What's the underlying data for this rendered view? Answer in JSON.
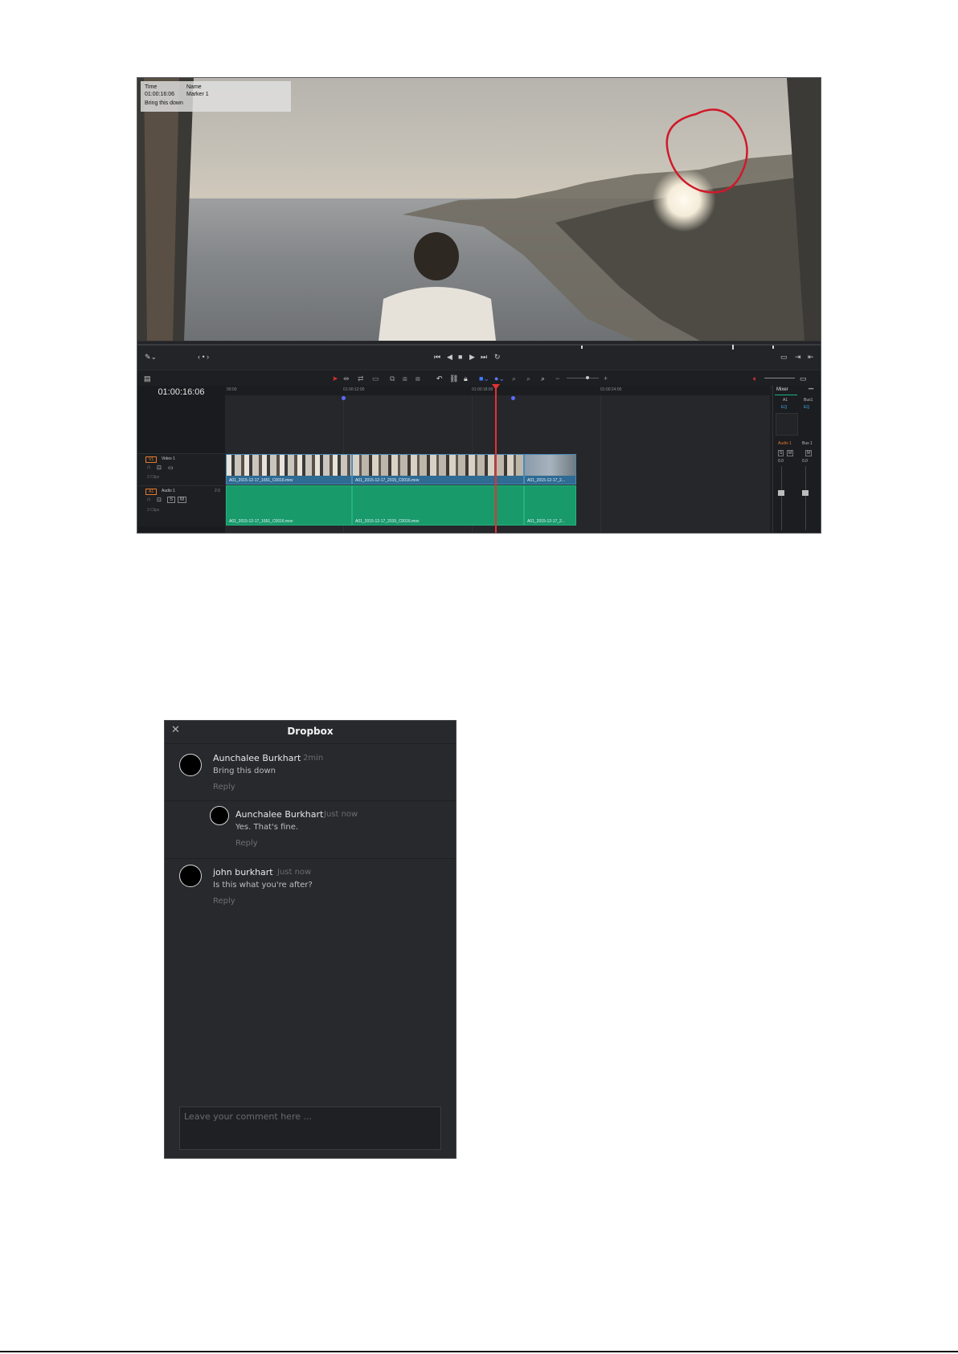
{
  "viewer": {
    "overlay": {
      "time_label": "Time",
      "time_value": "01:00:16:06",
      "name_label": "Name",
      "name_value": "Marker 1",
      "note": "Bring this down"
    },
    "annotation_color": "#d0192a"
  },
  "timeline": {
    "timecode": "01:00:16:06",
    "ruler_labels": [
      "00:00",
      "01:00:12:00",
      "01:00:18:00",
      "01:00:24:00"
    ],
    "tracks": {
      "video": {
        "id": "V1",
        "name": "Video 1",
        "clips_count": "3 Clips"
      },
      "audio": {
        "id": "A1",
        "name": "Audio 1",
        "level": "2.0",
        "clips_count": "3 Clips"
      }
    },
    "video_clips": [
      "A01_2015-12-17_1651_C0016.mov",
      "A01_2015-12-17_2015_C0016.mov",
      "A01_2015-12-17_2..."
    ],
    "audio_clips": [
      "A01_2015-12-17_1651_C0016.mov",
      "A01_2015-12-17_2015_C0016.mov",
      "A01_2015-12-17_2..."
    ]
  },
  "mixer": {
    "title": "Mixer",
    "more": "•••",
    "ch1": "A1",
    "ch2": "Bus1",
    "eq": "EQ",
    "audio1": "Audio 1",
    "bus1": "Bus 1",
    "m": "M",
    "s": "S",
    "level1": "0.0",
    "level2": "0.0"
  },
  "dropbox": {
    "title": "Dropbox",
    "comments": [
      {
        "author": "Aunchalee Burkhart",
        "time": "2min",
        "text": "Bring this down",
        "reply": "Reply"
      },
      {
        "author": "Aunchalee Burkhart",
        "time": "Just now",
        "text": "Yes. That's fine.",
        "reply": "Reply"
      },
      {
        "author": "john burkhart",
        "time": "Just now",
        "text": "Is this what you're after?",
        "reply": "Reply"
      }
    ],
    "input_placeholder": "Leave your comment here ..."
  },
  "colors": {
    "playhead": "#e23232",
    "video_clip": "#2f6b93",
    "audio_clip": "#199a6b",
    "panel_bg": "#28292d"
  }
}
